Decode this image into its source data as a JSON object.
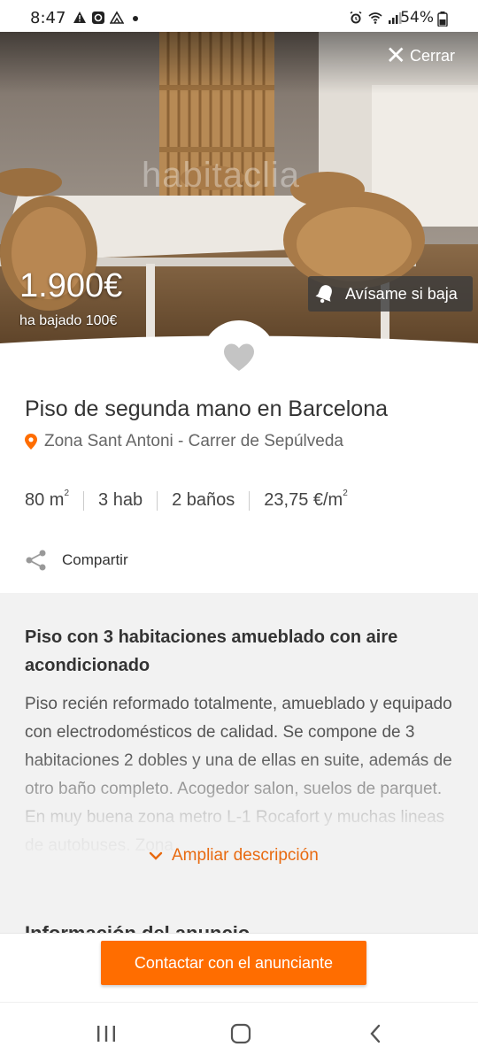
{
  "status_bar": {
    "time": "8:47",
    "battery": "54%",
    "icons_left": [
      "warning-icon",
      "app-icon",
      "drive-icon",
      "dot-icon"
    ],
    "icons_right": [
      "alarm-icon",
      "wifi-icon",
      "signal-icon",
      "battery-icon"
    ]
  },
  "hero": {
    "close_label": "Cerrar",
    "watermark": "habitaclia",
    "price": "1.900€",
    "price_drop": "ha bajado 100€",
    "alert_label": "Avísame si baja"
  },
  "listing": {
    "title": "Piso de segunda mano en Barcelona",
    "location": "Zona Sant Antoni - Carrer de Sepúlveda",
    "features": {
      "area": "80 m",
      "area_unit_sup": "2",
      "rooms": "3 hab",
      "baths": "2 baños",
      "price_per_m2": "23,75 €/m",
      "price_per_m2_sup": "2"
    },
    "share_label": "Compartir"
  },
  "description": {
    "title": "Piso con 3 habitaciones amueblado con aire acondicionado",
    "body": "Piso recién reformado totalmente, amueblado y equipado con electrodomésticos de calidad. Se compone de 3 habitaciones 2 dobles y una de ellas en suite, además de otro baño completo. Acogedor salon, suelos de parquet. En muy buena zona metro L-1 Rocafort y muchas lineas de autobuses. Zona",
    "expand_label": "Ampliar descripción",
    "next_heading": "Información del anuncio"
  },
  "contact": {
    "button_label": "Contactar con el anunciante"
  },
  "colors": {
    "accent": "#ff6d00",
    "link": "#e86a10"
  }
}
